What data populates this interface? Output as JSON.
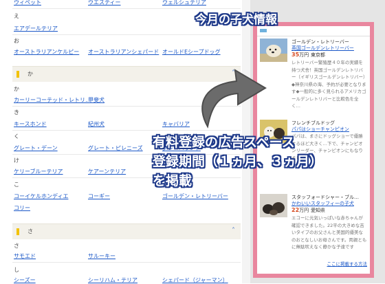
{
  "colors": {
    "link": "#1a57c7",
    "panel_border": "#e9879f",
    "price": "#d5481e",
    "overlay_outline": "#1f3a8a",
    "section_marker": "#f2c20a"
  },
  "breed_list": {
    "row0": [
      "ウィペット",
      "ウエスティー",
      "ウェルシュテリア"
    ],
    "kana_e": "え",
    "row_e": [
      "エアデールテリア"
    ],
    "kana_o": "お",
    "row_o": [
      "オーストラリアンケルピー",
      "オーストラリアンシェパード",
      "オールドEシープドッグ"
    ],
    "section_ka": {
      "label": "か",
      "icon": "chevron-up-icon"
    },
    "kana_ka": "か",
    "row_ka": [
      "カーリーコーテッド・レトリ…",
      "甲斐犬"
    ],
    "kana_ki": "き",
    "row_ki": [
      "キースホンド",
      "紀州犬",
      "キャバリア"
    ],
    "kana_ku": "く",
    "row_ku": [
      "グレート・デーン",
      "グレート・ピレニーズ",
      "グレーハウンド"
    ],
    "kana_ke": "け",
    "row_ke": [
      "ケリーブルーテリア",
      "ケアーンテリア"
    ],
    "kana_ko": "こ",
    "row_ko": [
      "コーイケルホンディエ",
      "コーギー",
      "ゴールデン・レトリーバー"
    ],
    "row_ko2": [
      "コリー"
    ],
    "section_sa": {
      "label": "さ",
      "icon": "chevron-up-icon"
    },
    "kana_sa": "さ",
    "row_sa": [
      "サモエド",
      "サルーキー"
    ],
    "kana_shi": "し",
    "row_shi": [
      "シーズー",
      "シーリハム・テリア",
      "シェパード（ジャーマン）"
    ]
  },
  "puppy_panel": {
    "entries": [
      {
        "breed": "ゴールデン・レトリーバー",
        "title": "英国ゴールデンレトリーバー",
        "price": "35",
        "price_unit": "万円",
        "location": "東京都",
        "desc": "レトリーバー繁殖歴４０年の実績を持つ犬舎！英国ゴールデンレトリバー（イギリスゴールデンレトリバー）◆神奈川県の海、予約が必要となります◆一般的に多く見られるアメリカゴールデンレトリバーと比較色を全く…"
      },
      {
        "breed": "フレンチブルドッグ",
        "title": "パパはショーチャンピオン",
        "price": "",
        "price_unit": "",
        "location": "",
        "desc": "パパは、まさにドッグショーで優勝するほど大きく…下で、チャンピオンリーダー、チャンピオンにもなりました。"
      },
      {
        "breed": "スタッフォードシャー・ブル…",
        "title": "かわいいスタッフィーの子犬",
        "price": "22",
        "price_unit": "万円",
        "location": "愛知県",
        "desc": "エコーに元気いっぱいな赤ちゃんが確認できました。22平の大きめな吉いタイプのお父さんと美国的優美なのおとなしいお母さんです。両親ともに無駄吠えなく静かな子達です"
      }
    ],
    "more_link": "ここに掲載する方法"
  },
  "overlay": {
    "title": "今月の子犬情報",
    "line1": "有料登録の広告スペース",
    "line2": "登録期間（１ヵ月、３ヵ月）",
    "line3": "を掲載"
  }
}
